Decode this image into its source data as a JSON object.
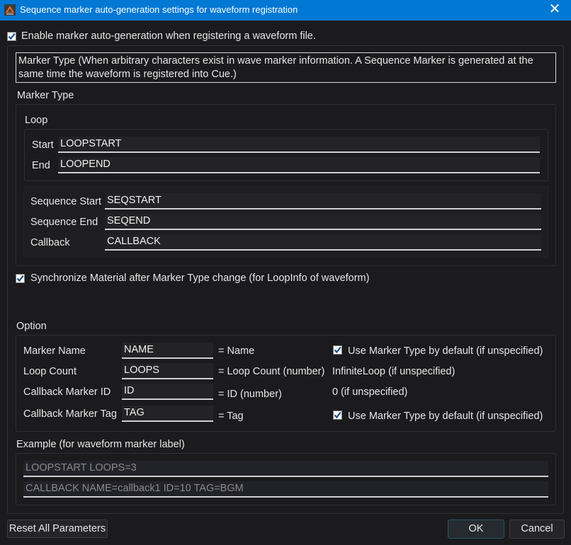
{
  "window": {
    "title": "Sequence marker auto-generation settings for waveform registration",
    "close_symbol": "✕"
  },
  "enable_checkbox": {
    "label": "Enable marker auto-generation when registering a waveform file.",
    "checked": true
  },
  "description": "Marker Type (When arbitrary characters exist in wave marker information. A Sequence Marker is generated at the same time the waveform is registered into Cue.)",
  "marker_type": {
    "heading": "Marker Type",
    "loop": {
      "heading": "Loop",
      "fields": [
        {
          "label": "Start",
          "value": "LOOPSTART"
        },
        {
          "label": "End",
          "value": "LOOPEND"
        }
      ]
    },
    "sequence": {
      "fields": [
        {
          "label": "Sequence Start",
          "value": "SEQSTART"
        },
        {
          "label": "Sequence End",
          "value": "SEQEND"
        },
        {
          "label": "Callback",
          "value": "CALLBACK"
        }
      ]
    }
  },
  "sync_checkbox": {
    "label": "Synchronize Material after Marker Type change (for LoopInfo of waveform)",
    "checked": true
  },
  "option": {
    "heading": "Option",
    "rows": [
      {
        "label": "Marker Name",
        "value": "NAME",
        "meaning": "= Name",
        "extra": "Use Marker Type by default (if unspecified)",
        "extra_is_checkbox": true,
        "checked": true
      },
      {
        "label": "Loop Count",
        "value": "LOOPS",
        "meaning": "= Loop Count (number)",
        "extra": "InfiniteLoop (if unspecified)",
        "extra_is_checkbox": false
      },
      {
        "label": "Callback Marker ID",
        "value": "ID",
        "meaning": "= ID (number)",
        "extra": "0 (if unspecified)",
        "extra_is_checkbox": false
      },
      {
        "label": "Callback Marker Tag",
        "value": "TAG",
        "meaning": "= Tag",
        "extra": "Use Marker Type by default (if unspecified)",
        "extra_is_checkbox": true,
        "checked": true
      }
    ]
  },
  "example": {
    "heading": "Example (for waveform marker label)",
    "lines": [
      "LOOPSTART LOOPS=3",
      "CALLBACK NAME=callback1 ID=10 TAG=BGM"
    ]
  },
  "buttons": {
    "reset": "Reset All Parameters",
    "ok": "OK",
    "cancel": "Cancel"
  },
  "colors": {
    "titlebar": "#0078d4",
    "background": "#1b1b1d",
    "checkbox_check": "#1f4e8c",
    "ok_border": "#2e5363"
  }
}
